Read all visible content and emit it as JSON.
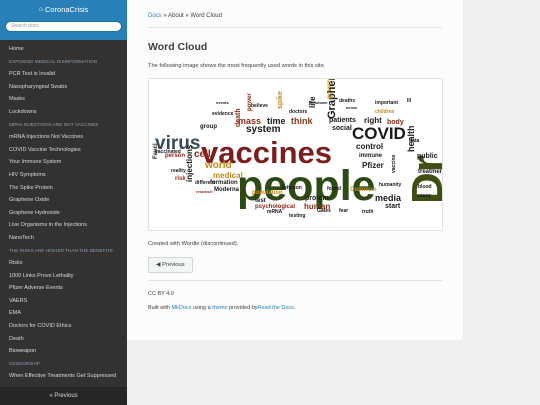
{
  "sidebar": {
    "brand": "CoronaCrisis",
    "search_placeholder": "Search docs",
    "nav": [
      {
        "type": "item",
        "label": "Home"
      },
      {
        "type": "caption",
        "label": "EXPOSING MEDICAL DISINFORMATION"
      },
      {
        "type": "item",
        "label": "PCR Test is Invalid"
      },
      {
        "type": "item",
        "label": "Nasopharyngeal Swabs"
      },
      {
        "type": "item",
        "label": "Masks"
      },
      {
        "type": "item",
        "label": "Lockdowns"
      },
      {
        "type": "caption",
        "label": "MRNA INJECTIONS ARE NOT VACCINES"
      },
      {
        "type": "item",
        "label": "mRNA Injections Not Vaccines"
      },
      {
        "type": "item",
        "label": "COVID Vaccine Technologies"
      },
      {
        "type": "item",
        "label": "Your Immune System"
      },
      {
        "type": "item",
        "label": "HIV Symptoms"
      },
      {
        "type": "item",
        "label": "The Spike Protein"
      },
      {
        "type": "item",
        "label": "Graphene Oxide"
      },
      {
        "type": "item",
        "label": "Graphene Hydroxide"
      },
      {
        "type": "item",
        "label": "Live Organisms in the Injections"
      },
      {
        "type": "item",
        "label": "NanoTech"
      },
      {
        "type": "caption",
        "label": "THE RISKS ARE HIGHER THAN THE BENEFITS"
      },
      {
        "type": "item",
        "label": "Risks"
      },
      {
        "type": "item",
        "label": "1000 Links Prove Lethality"
      },
      {
        "type": "item",
        "label": "Pfizer Adverse Events"
      },
      {
        "type": "item",
        "label": "VAERS"
      },
      {
        "type": "item",
        "label": "EMA"
      },
      {
        "type": "item",
        "label": "Doctors for COVID Ethics"
      },
      {
        "type": "item",
        "label": "Death"
      },
      {
        "type": "item",
        "label": "Bioweapon"
      },
      {
        "type": "caption",
        "label": "CENSORSHIP"
      },
      {
        "type": "item",
        "label": "When Effective Treatments Get Suppressed"
      }
    ],
    "prev_label": "« Previous"
  },
  "breadcrumb": {
    "docs": "Docs",
    "sep": "»",
    "about": "About",
    "sep2": "»",
    "current": "Word Cloud"
  },
  "page": {
    "title": "Word Cloud",
    "intro": "The following image shows the most frequently used words in this site.",
    "caption": "Created with Wordle (discontinued).",
    "prev_button": "Previous"
  },
  "footer": {
    "license": "CC BY 4.0",
    "built_with": "Built with",
    "mkdocs": "MkDocs",
    "using_a": "using a",
    "theme": "theme",
    "provided_by": "provided by",
    "rtd": "Read the Docs",
    "period": "."
  },
  "wordcloud": {
    "words": [
      {
        "text": "vaccines",
        "color": "#7a1f1f"
      },
      {
        "text": "people",
        "color": "#2d4a14"
      },
      {
        "text": "COVID",
        "color": "#1a1a1a"
      },
      {
        "text": "virus",
        "color": "#3a4a5a"
      },
      {
        "text": "system",
        "color": "#1a1a1a"
      },
      {
        "text": "Dr",
        "color": "#3d4f12"
      },
      {
        "text": "mass",
        "color": "#8b2a1a"
      },
      {
        "text": "time",
        "color": "#1a1a1a"
      },
      {
        "text": "think",
        "color": "#8b3a1a"
      },
      {
        "text": "patients",
        "color": "#1a1a1a"
      },
      {
        "text": "right",
        "color": "#1a1a1a"
      },
      {
        "text": "body",
        "color": "#8b2a1a"
      },
      {
        "text": "control",
        "color": "#1a1a1a"
      },
      {
        "text": "immune",
        "color": "#1a1a1a"
      },
      {
        "text": "Pfizer",
        "color": "#1a1a1a"
      },
      {
        "text": "cell",
        "color": "#8b2a1a"
      },
      {
        "text": "world",
        "color": "#c28a1a"
      },
      {
        "text": "medical",
        "color": "#c28a1a"
      },
      {
        "text": "formation",
        "color": "#1a1a1a"
      },
      {
        "text": "Moderna",
        "color": "#1a1a1a"
      },
      {
        "text": "protein",
        "color": "#1a1a1a"
      },
      {
        "text": "human",
        "color": "#8b2a1a"
      },
      {
        "text": "media",
        "color": "#1a1a1a"
      },
      {
        "text": "start",
        "color": "#1a1a1a"
      },
      {
        "text": "test",
        "color": "#1a1a1a"
      },
      {
        "text": "public",
        "color": "#1a1a1a"
      },
      {
        "text": "doctors",
        "color": "#1a1a1a"
      },
      {
        "text": "social",
        "color": "#1a1a1a"
      },
      {
        "text": "Graphene",
        "color": "#1a1a1a"
      },
      {
        "text": "injections",
        "color": "#1a1a1a"
      },
      {
        "text": "health",
        "color": "#1a1a1a"
      },
      {
        "text": "children",
        "color": "#c28a1a"
      },
      {
        "text": "risk",
        "color": "#8b2a1a"
      },
      {
        "text": "death",
        "color": "#8b2a1a"
      },
      {
        "text": "population",
        "color": "#c28a1a"
      },
      {
        "text": "different",
        "color": "#1a1a1a"
      },
      {
        "text": "power",
        "color": "#8b2a1a"
      },
      {
        "text": "spike",
        "color": "#c28a1a"
      },
      {
        "text": "life",
        "color": "#1a1a1a"
      },
      {
        "text": "government",
        "color": "#c28a1a"
      },
      {
        "text": "treatment",
        "color": "#1a1a1a"
      },
      {
        "text": "psychological",
        "color": "#8b2a1a"
      },
      {
        "text": "research",
        "color": "#8b2a1a"
      },
      {
        "text": "group",
        "color": "#1a1a1a"
      },
      {
        "text": "important",
        "color": "#1a1a1a"
      },
      {
        "text": "person",
        "color": "#8b2a1a"
      },
      {
        "text": "vaccinated",
        "color": "#1a1a1a"
      },
      {
        "text": "reality",
        "color": "#1a1a1a"
      },
      {
        "text": "Fauci",
        "color": "#1a1a1a"
      },
      {
        "text": "believe",
        "color": "#1a1a1a"
      },
      {
        "text": "humanity",
        "color": "#1a1a1a"
      },
      {
        "text": "Common",
        "color": "#c28a1a"
      },
      {
        "text": "Johnson",
        "color": "#1a1a1a"
      },
      {
        "text": "found",
        "color": "#1a1a1a"
      },
      {
        "text": "blood",
        "color": "#1a1a1a"
      },
      {
        "text": "data",
        "color": "#1a1a1a"
      },
      {
        "text": "mRNA",
        "color": "#1a1a1a"
      },
      {
        "text": "Gates",
        "color": "#1a1a1a"
      },
      {
        "text": "deaths",
        "color": "#1a1a1a"
      },
      {
        "text": "fear",
        "color": "#1a1a1a"
      },
      {
        "text": "cases",
        "color": "#1a1a1a"
      },
      {
        "text": "testing",
        "color": "#1a1a1a"
      },
      {
        "text": "lockdown",
        "color": "#1a1a1a"
      },
      {
        "text": "sense",
        "color": "#1a1a1a"
      },
      {
        "text": "truth",
        "color": "#1a1a1a"
      },
      {
        "text": "events",
        "color": "#1a1a1a"
      },
      {
        "text": "vaccine",
        "color": "#1a1a1a"
      },
      {
        "text": "evidence",
        "color": "#1a1a1a"
      },
      {
        "text": "Ill",
        "color": "#1a1a1a"
      }
    ]
  }
}
